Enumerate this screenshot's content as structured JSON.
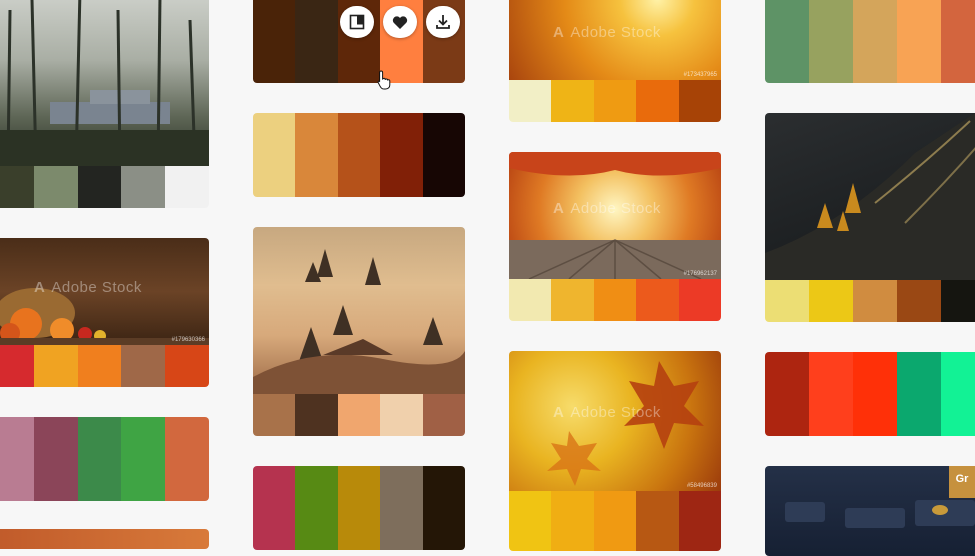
{
  "watermark": {
    "text": "Adobe Stock",
    "logo_glyph": "A"
  },
  "cards": [
    {
      "id": "c1-forest",
      "stock_id": "",
      "swatches": [
        "#3a3f2b",
        "#7c8a6c",
        "#232521",
        "#8b8f86",
        "#f1f1f1"
      ]
    },
    {
      "id": "c1-harvest",
      "stock_id": "#179630366",
      "swatches": [
        "#d62a2e",
        "#f0a322",
        "#f07f1e",
        "#9f6848",
        "#d74617"
      ]
    },
    {
      "id": "c1-palette-a",
      "swatches": [
        "#b97c92",
        "#8b4559",
        "#3c8a4a",
        "#3fa444",
        "#d2683e"
      ]
    },
    {
      "id": "c2-hovered",
      "swatches": [
        "#4a2308",
        "#3a2614",
        "#5e2709",
        "#ff7f3f",
        "#7b3a16"
      ]
    },
    {
      "id": "c2-palette-b",
      "swatches": [
        "#ecd07f",
        "#d9873a",
        "#b5521a",
        "#812007",
        "#170604"
      ]
    },
    {
      "id": "c2-fog",
      "swatches": [
        "#a8724a",
        "#4e3220",
        "#f0a66e",
        "#f0d0ac",
        "#a06045"
      ]
    },
    {
      "id": "c2-palette-c",
      "swatches": [
        "#b5334f",
        "#578a14",
        "#b88a0a",
        "#7e6e5c",
        "#241606"
      ]
    },
    {
      "id": "c3-leaves",
      "stock_id": "#173437965",
      "swatches": [
        "#f2efc6",
        "#efb416",
        "#ef9b12",
        "#e96b0c",
        "#a74306"
      ]
    },
    {
      "id": "c3-table",
      "stock_id": "#176962137",
      "swatches": [
        "#f2e9b0",
        "#efb52e",
        "#f08e14",
        "#ec5a1c",
        "#ec3a26"
      ]
    },
    {
      "id": "c3-maple",
      "stock_id": "#58496839",
      "swatches": [
        "#f0c413",
        "#f0ae13",
        "#f09a12",
        "#b75813",
        "#9e2613"
      ]
    },
    {
      "id": "c4-palette-d",
      "swatches": [
        "#5e9366",
        "#97a25f",
        "#d4a55b",
        "#f8a354",
        "#d3653e"
      ]
    },
    {
      "id": "c4-hills",
      "swatches": [
        "#ecde74",
        "#ecc816",
        "#d08c40",
        "#9a4814",
        "#151510"
      ]
    },
    {
      "id": "c4-palette-e",
      "swatches": [
        "#ad2510",
        "#ff3f1c",
        "#ff3008",
        "#0ba86e",
        "#12f295"
      ]
    },
    {
      "id": "c4-dark",
      "badge": "Gr"
    }
  ],
  "hover_actions": [
    {
      "name": "open-panel-button",
      "icon": "panel-icon"
    },
    {
      "name": "like-button",
      "icon": "heart-icon"
    },
    {
      "name": "download-button",
      "icon": "download-icon"
    }
  ]
}
